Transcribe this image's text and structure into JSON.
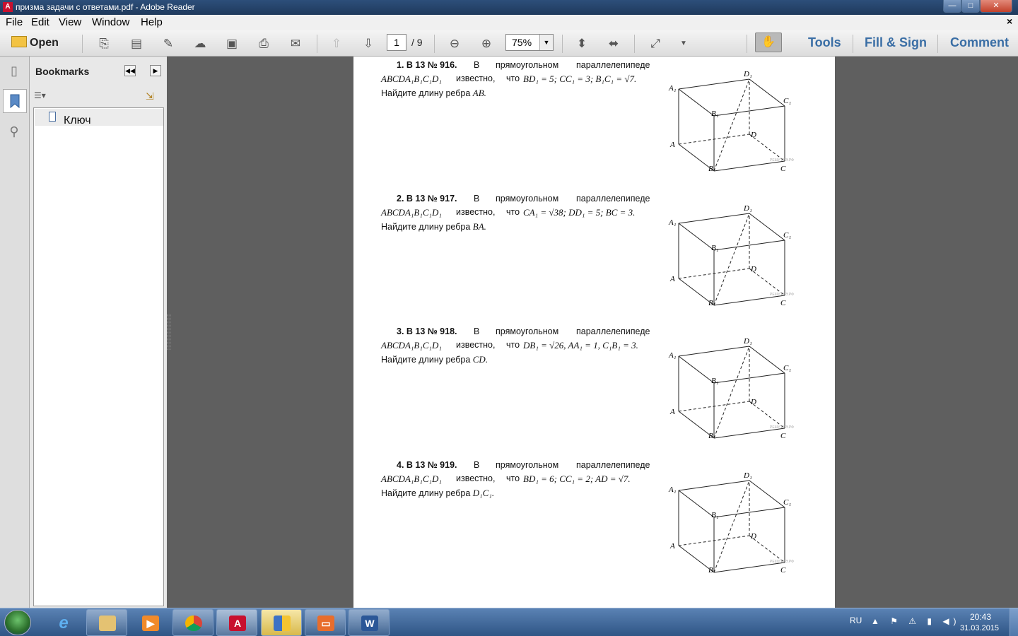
{
  "window": {
    "title": "призма задачи с ответами.pdf - Adobe Reader",
    "minimize": "—",
    "maximize": "□",
    "close": "✕"
  },
  "menu": {
    "items": [
      "File",
      "Edit",
      "View",
      "Window",
      "Help"
    ],
    "close": "×"
  },
  "toolbar": {
    "open_label": "Open",
    "page_current": "1",
    "page_total": "/ 9",
    "zoom": "75%",
    "right_tabs": [
      "Tools",
      "Fill & Sign",
      "Comment"
    ],
    "icons": [
      "create-pdf-icon",
      "export-pdf-icon",
      "edit-icon",
      "upload-cloud-icon",
      "save-icon",
      "print-icon",
      "email-icon",
      "prev-page-icon",
      "next-page-icon",
      "zoom-out-icon",
      "zoom-in-icon",
      "fit-page-icon",
      "fit-width-icon",
      "fullscreen-icon",
      "read-mode-icon",
      "hand-tool-icon"
    ]
  },
  "sidebar": {
    "title": "Bookmarks",
    "items": [
      {
        "label": "Ключ"
      }
    ]
  },
  "problems": [
    {
      "number": "1. B 13 № 916.",
      "words": [
        "В",
        "прямоугольном",
        "параллелепипеде"
      ],
      "shape": "ABCDA₁B₁C₁D₁",
      "known": "известно,",
      "chto": "что",
      "given": "BD₁ = 5;  CC₁ = 3;  B₁C₁ = √7.",
      "question": "Найдите длину ребра",
      "edge": "AB."
    },
    {
      "number": "2. B 13 № 917.",
      "words": [
        "В",
        "прямоугольном",
        "параллелепипеде"
      ],
      "shape": "ABCDA₁B₁C₁D₁",
      "known": "известно,",
      "chto": "что",
      "given": "CA₁ = √38;  DD₁ = 5;  BC = 3.",
      "question": "Найдите длину ребра",
      "edge": "BA."
    },
    {
      "number": "3. B 13 № 918.",
      "words": [
        "В",
        "прямоугольном",
        "параллелепипеде"
      ],
      "shape": "ABCDA₁B₁C₁D₁",
      "known": "известно,",
      "chto": "что",
      "given": "DB₁ = √26, AA₁ = 1, C₁B₁ = 3.",
      "question": "Найдите длину ребра",
      "edge": "CD."
    },
    {
      "number": "4. B 13 № 919.",
      "words": [
        "В",
        "прямоугольном",
        "параллелепипеде"
      ],
      "shape": "ABCDA₁B₁C₁D₁",
      "known": "известно,",
      "chto": "что",
      "given": "BD₁ = 6;  CC₁ = 2;  AD = √7.",
      "question": "Найдите длину ребра",
      "edge": "D₁C₁."
    }
  ],
  "figure_labels": {
    "A1": "A₁",
    "D1": "D₁",
    "B1": "B₁",
    "C1": "C₁",
    "A": "A",
    "D": "D",
    "B": "B",
    "C": "C",
    "watermark": "РЕШУ ЕГЭ.РФ"
  },
  "tray": {
    "lang": "RU",
    "time": "20:43",
    "date": "31.03.2015"
  }
}
